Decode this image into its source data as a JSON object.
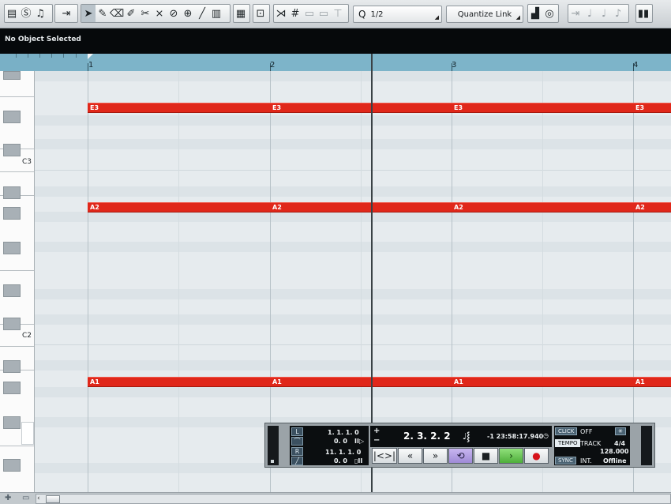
{
  "toolbar": {
    "quantize_label": "Q",
    "quantize_value": "1/2",
    "quantize_link": "Quantize Link"
  },
  "info_line": {
    "text": "No Object Selected"
  },
  "ruler": {
    "bars": [
      "1",
      "2",
      "3",
      "4"
    ]
  },
  "keyboard": {
    "labels": [
      "C3",
      "C2"
    ]
  },
  "notes": [
    {
      "pitch": "E3",
      "segments": [
        "E3",
        "E3",
        "E3",
        "E3"
      ]
    },
    {
      "pitch": "A2",
      "segments": [
        "A2",
        "A2",
        "A2",
        "A2"
      ]
    },
    {
      "pitch": "A1",
      "segments": [
        "A1",
        "A1",
        "A1",
        "A1"
      ]
    }
  ],
  "transport": {
    "left_locator_btn": "L",
    "right_locator_btn": "R",
    "left_locator": "1. 1. 1. 0",
    "left_locator_sub": "0. 0",
    "right_locator": "11. 1. 1. 0",
    "right_locator_sub": "0. 0",
    "position": "2. 3. 2. 2",
    "time": "-1 23:58:17.940",
    "click_label": "CLICK",
    "click_value": "OFF",
    "tempo_label": "TEMPO",
    "tempo_mode": "TRACK",
    "signature": "4/4",
    "tempo_value": "128.000",
    "sync_label": "SYNC",
    "sync_source": "INT.",
    "sync_status": "Offline"
  }
}
